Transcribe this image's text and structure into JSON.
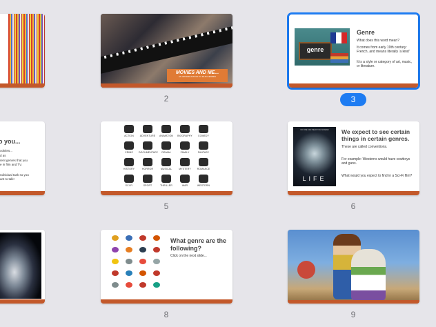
{
  "slides": [
    {
      "id": 1,
      "number": ""
    },
    {
      "id": 2,
      "number": "2",
      "banner_title": "MOVIES AND ME...",
      "banner_sub": "AN INTRODUCTION TO FILM GENRES"
    },
    {
      "id": 3,
      "number": "3",
      "selected": true,
      "title": "Genre",
      "chalk_word": "genre",
      "lines": [
        "What does this word mean?",
        "It comes from early 19th century: French, and means literally 'a kind'",
        "It is a style or category of art, music, or literature."
      ]
    },
    {
      "id": 4,
      "number": "",
      "title": "o you...",
      "lines": [
        "ooklets...",
        "d as",
        "rent genres that you",
        "e in film and TV.",
        "ndividual task so you",
        "ant to talk!"
      ]
    },
    {
      "id": 5,
      "number": "5",
      "icon_labels": [
        "ACTION",
        "ADVENTURE",
        "ANIMATION",
        "BIOGRAPHY",
        "COMEDY",
        "CRIME",
        "DOCUMENTARY",
        "DRAMA",
        "FAMILY",
        "FANTASY",
        "HISTORY",
        "HORROR",
        "MUSICAL",
        "MYSTERY",
        "ROMANCE",
        "SCI-FI",
        "SPORT",
        "THRILLER",
        "WAR",
        "WESTERN"
      ]
    },
    {
      "id": 6,
      "number": "6",
      "title": "We expect to see certain things in certain genres.",
      "subtitle": "These are called conventions.",
      "lines": [
        "For example: Westerns would have cowboys and guns.",
        "What would you expect to find in a Sci-Fi film?"
      ],
      "poster_tag": "NO ONE CAN HEAR YOU SCREAM",
      "poster_title": "LIFE"
    },
    {
      "id": 7,
      "number": ""
    },
    {
      "id": 8,
      "number": "8",
      "title": "What genre are the following?",
      "subtitle": "Click on the next slide..."
    },
    {
      "id": 9,
      "number": "9"
    }
  ]
}
